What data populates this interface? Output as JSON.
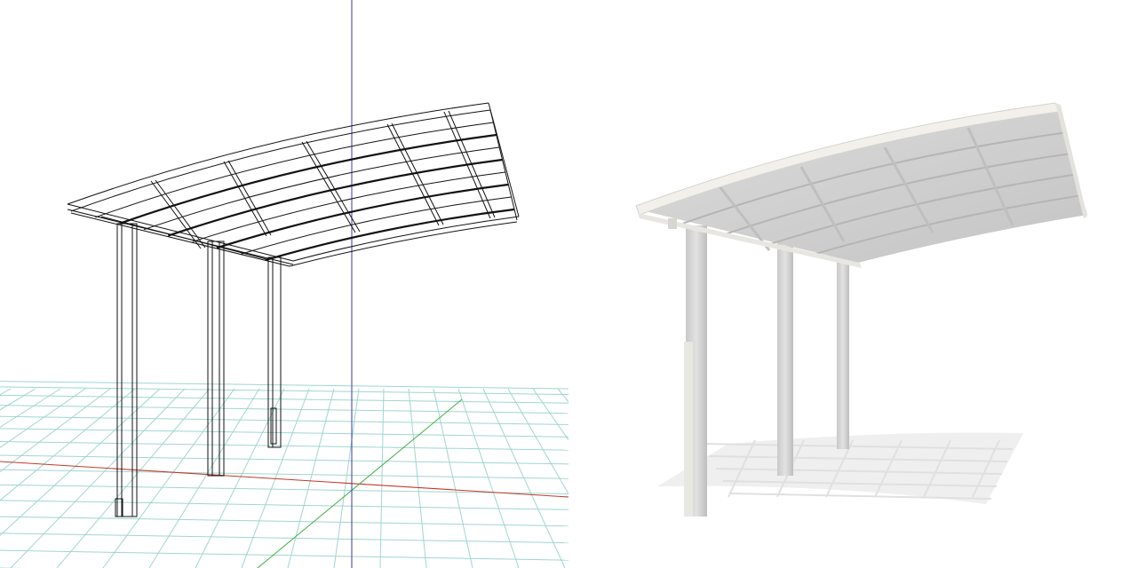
{
  "views": {
    "wireframe": {
      "name": "wireframe-viewport",
      "style": "wireframe"
    },
    "render": {
      "name": "shaded-render-viewport",
      "style": "shaded"
    }
  },
  "colors": {
    "background": "#ffffff",
    "wire": "#111111",
    "grid": "#9fd6d0",
    "axis_x": "#c0392b",
    "axis_y": "#3cb043",
    "axis_z": "#3a3aa8",
    "render_frame": "#e6e4df",
    "render_panel": "#d3d3d3",
    "render_shadow": "#ececec"
  }
}
